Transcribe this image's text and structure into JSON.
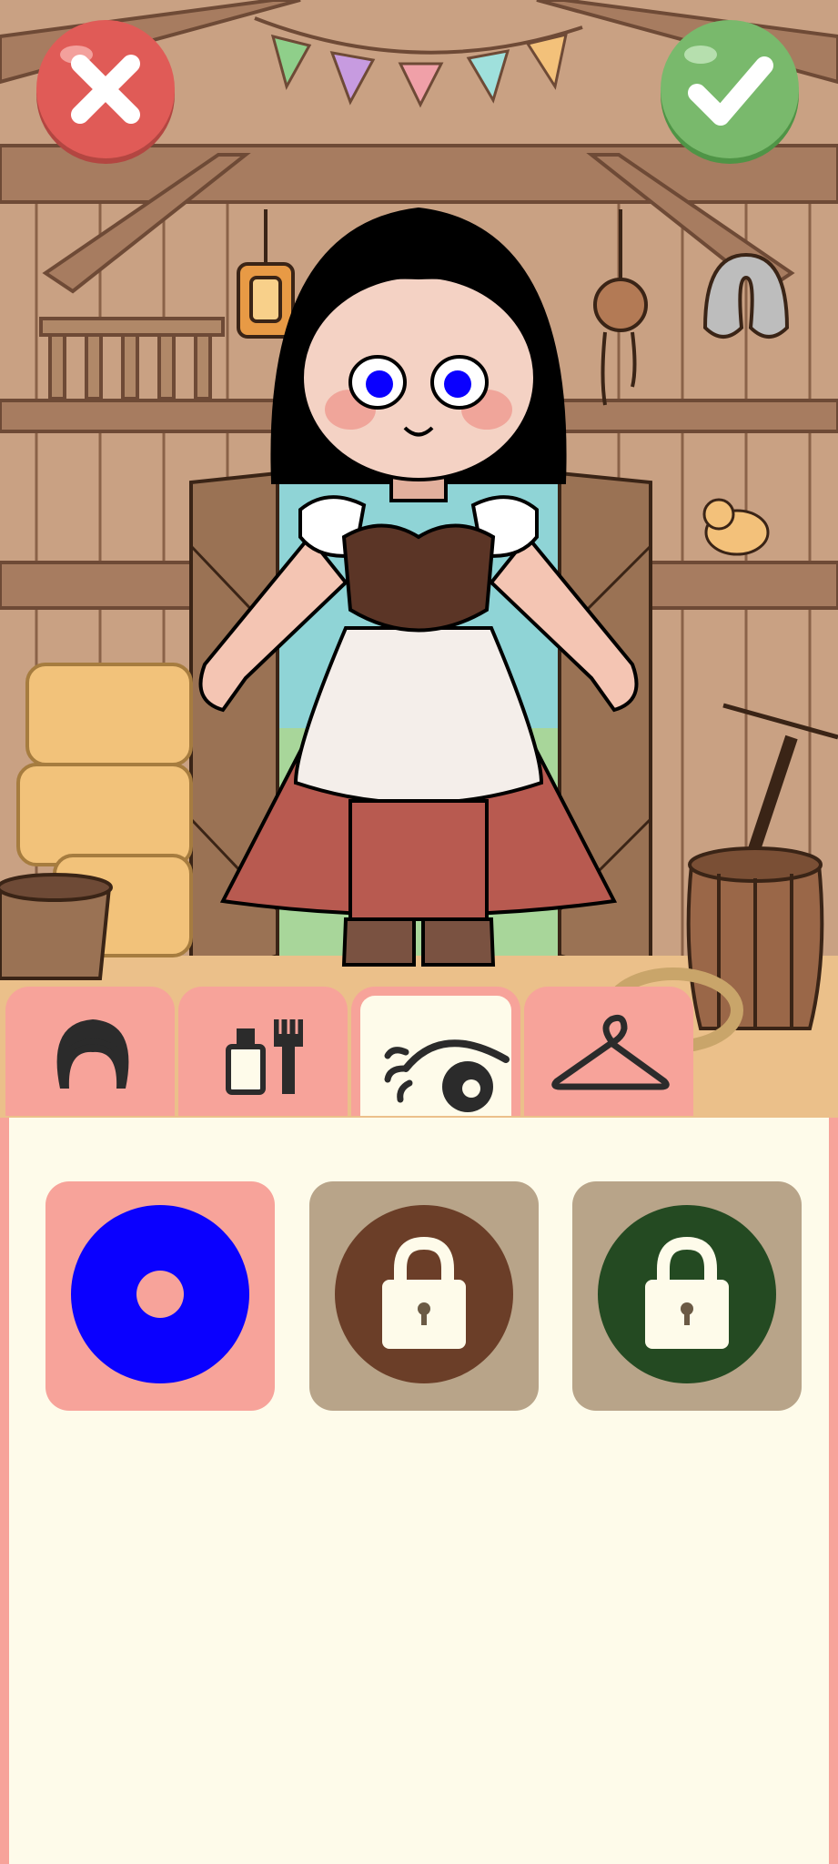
{
  "header": {
    "close_button": {
      "icon": "close-x-icon",
      "color": "#e05b57"
    },
    "confirm_button": {
      "icon": "checkmark-icon",
      "color": "#79b96c"
    }
  },
  "character": {
    "hair_color": "#000000",
    "eye_color": "#0a00ff",
    "outfit": "peasant-dress"
  },
  "tabs": [
    {
      "icon": "hair-icon",
      "active": false
    },
    {
      "icon": "makeup-brush-icon",
      "active": false
    },
    {
      "icon": "eye-icon",
      "active": true
    },
    {
      "icon": "hanger-icon",
      "active": false
    }
  ],
  "eye_colors": [
    {
      "color": "#0a00ff",
      "locked": false,
      "selected": true
    },
    {
      "color": "#6b3e28",
      "locked": true,
      "selected": false
    },
    {
      "color": "#244a22",
      "locked": true,
      "selected": false
    }
  ],
  "colors": {
    "panel_border": "#f7a39a",
    "panel_bg": "#fefbea",
    "locked_tile": "#b8a489",
    "selected_tile": "#f7a39a"
  }
}
